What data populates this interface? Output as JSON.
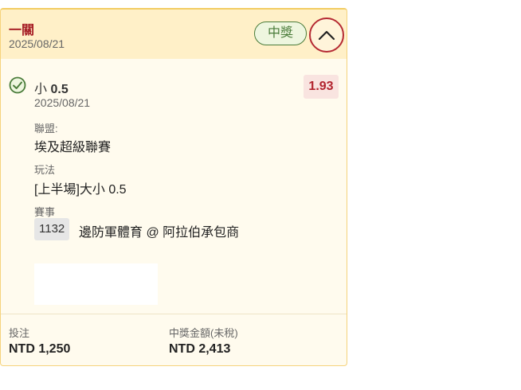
{
  "card": {
    "title": "一關",
    "date": "2025/08/21",
    "status_label": "中獎",
    "collapse_icon": "chevron-up-icon",
    "colors": {
      "accent_red": "#a61d24",
      "win_green": "#4a7c3a",
      "header_bg": "#fff0c8",
      "card_bg": "#fffbee"
    }
  },
  "selection": {
    "status_icon": "check-circle-icon",
    "prefix": "小",
    "line": "0.5",
    "odds": "1.93",
    "date": "2025/08/21",
    "league_label": "聯盟:",
    "league_value": "埃及超級聯賽",
    "market_label": "玩法",
    "market_value": "[上半場]大小 0.5",
    "match_label": "賽事",
    "match_id": "1132",
    "match_name": "邊防軍體育 @ 阿拉伯承包商"
  },
  "footer": {
    "stake_label": "投注",
    "stake_value": "NTD 1,250",
    "payout_label": "中獎金額(未稅)",
    "payout_value": "NTD 2,413"
  }
}
